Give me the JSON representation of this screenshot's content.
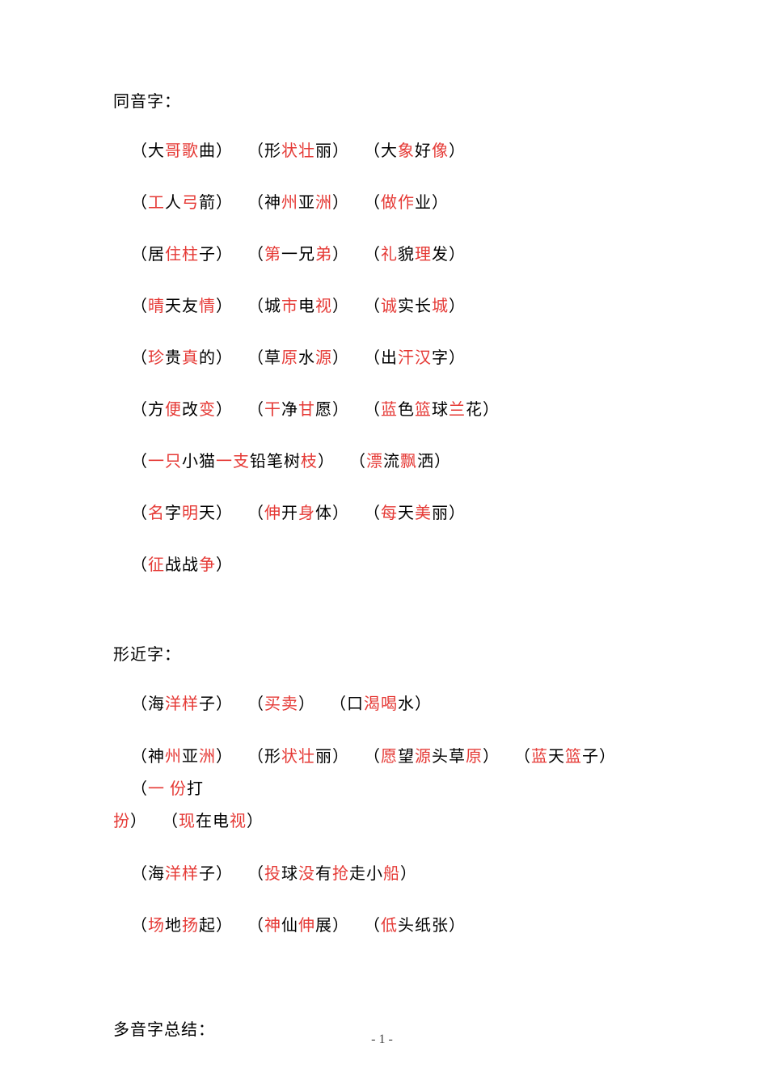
{
  "footer": {
    "pageNumber": "- 1 -"
  },
  "sections": {
    "homophones": {
      "title": "同音字：",
      "rows": [
        [
          {
            "segs": [
              {
                "t": "（大",
                "r": 0
              },
              {
                "t": "哥歌",
                "r": 1
              },
              {
                "t": "曲）",
                "r": 0
              }
            ]
          },
          {
            "segs": [
              {
                "t": "（形",
                "r": 0
              },
              {
                "t": "状壮",
                "r": 1
              },
              {
                "t": "丽）",
                "r": 0
              }
            ]
          },
          {
            "segs": [
              {
                "t": "（大",
                "r": 0
              },
              {
                "t": "象",
                "r": 1
              },
              {
                "t": "好",
                "r": 0
              },
              {
                "t": "像",
                "r": 1
              },
              {
                "t": "）",
                "r": 0
              }
            ]
          }
        ],
        [
          {
            "segs": [
              {
                "t": "（",
                "r": 0
              },
              {
                "t": "工",
                "r": 1
              },
              {
                "t": "人",
                "r": 0
              },
              {
                "t": "弓",
                "r": 1
              },
              {
                "t": "箭）",
                "r": 0
              }
            ]
          },
          {
            "segs": [
              {
                "t": "（神",
                "r": 0
              },
              {
                "t": "州",
                "r": 1
              },
              {
                "t": "亚",
                "r": 0
              },
              {
                "t": "洲",
                "r": 1
              },
              {
                "t": "）",
                "r": 0
              }
            ]
          },
          {
            "segs": [
              {
                "t": "（",
                "r": 0
              },
              {
                "t": "做作",
                "r": 1
              },
              {
                "t": "业）",
                "r": 0
              }
            ]
          }
        ],
        [
          {
            "segs": [
              {
                "t": "（居",
                "r": 0
              },
              {
                "t": "住柱",
                "r": 1
              },
              {
                "t": "子）",
                "r": 0
              }
            ]
          },
          {
            "segs": [
              {
                "t": "（",
                "r": 0
              },
              {
                "t": "第",
                "r": 1
              },
              {
                "t": "一兄",
                "r": 0
              },
              {
                "t": "弟",
                "r": 1
              },
              {
                "t": "）",
                "r": 0
              }
            ]
          },
          {
            "segs": [
              {
                "t": "（",
                "r": 0
              },
              {
                "t": "礼",
                "r": 1
              },
              {
                "t": "貌",
                "r": 0
              },
              {
                "t": "理",
                "r": 1
              },
              {
                "t": "发）",
                "r": 0
              }
            ]
          }
        ],
        [
          {
            "segs": [
              {
                "t": "（",
                "r": 0
              },
              {
                "t": "晴",
                "r": 1
              },
              {
                "t": "天友",
                "r": 0
              },
              {
                "t": "情",
                "r": 1
              },
              {
                "t": "）",
                "r": 0
              }
            ]
          },
          {
            "segs": [
              {
                "t": "（城",
                "r": 0
              },
              {
                "t": "市",
                "r": 1
              },
              {
                "t": "电",
                "r": 0
              },
              {
                "t": "视",
                "r": 1
              },
              {
                "t": "）",
                "r": 0
              }
            ]
          },
          {
            "segs": [
              {
                "t": "（",
                "r": 0
              },
              {
                "t": "诚",
                "r": 1
              },
              {
                "t": "实长",
                "r": 0
              },
              {
                "t": "城",
                "r": 1
              },
              {
                "t": "）",
                "r": 0
              }
            ]
          }
        ],
        [
          {
            "segs": [
              {
                "t": "（",
                "r": 0
              },
              {
                "t": "珍",
                "r": 1
              },
              {
                "t": "贵",
                "r": 0
              },
              {
                "t": "真",
                "r": 1
              },
              {
                "t": "的）",
                "r": 0
              }
            ]
          },
          {
            "segs": [
              {
                "t": "（草",
                "r": 0
              },
              {
                "t": "原",
                "r": 1
              },
              {
                "t": "水",
                "r": 0
              },
              {
                "t": "源",
                "r": 1
              },
              {
                "t": "）",
                "r": 0
              }
            ]
          },
          {
            "segs": [
              {
                "t": "（出",
                "r": 0
              },
              {
                "t": "汗汉",
                "r": 1
              },
              {
                "t": "字）",
                "r": 0
              }
            ]
          }
        ],
        [
          {
            "segs": [
              {
                "t": "（方",
                "r": 0
              },
              {
                "t": "便",
                "r": 1
              },
              {
                "t": "改",
                "r": 0
              },
              {
                "t": "变",
                "r": 1
              },
              {
                "t": "）",
                "r": 0
              }
            ]
          },
          {
            "segs": [
              {
                "t": "（",
                "r": 0
              },
              {
                "t": "干",
                "r": 1
              },
              {
                "t": "净",
                "r": 0
              },
              {
                "t": "甘",
                "r": 1
              },
              {
                "t": "愿）",
                "r": 0
              }
            ]
          },
          {
            "segs": [
              {
                "t": "（",
                "r": 0
              },
              {
                "t": "蓝",
                "r": 1
              },
              {
                "t": "色",
                "r": 0
              },
              {
                "t": "篮",
                "r": 1
              },
              {
                "t": "球",
                "r": 0
              },
              {
                "t": "兰",
                "r": 1
              },
              {
                "t": "花）",
                "r": 0
              }
            ]
          }
        ],
        [
          {
            "segs": [
              {
                "t": "（",
                "r": 0
              },
              {
                "t": "一只",
                "r": 1
              },
              {
                "t": "小猫",
                "r": 0
              },
              {
                "t": "一支",
                "r": 1
              },
              {
                "t": "铅笔树",
                "r": 0
              },
              {
                "t": "枝",
                "r": 1
              },
              {
                "t": "）",
                "r": 0
              }
            ]
          },
          {
            "segs": [
              {
                "t": "（",
                "r": 0
              },
              {
                "t": "漂",
                "r": 1
              },
              {
                "t": "流",
                "r": 0
              },
              {
                "t": "飘",
                "r": 1
              },
              {
                "t": "洒）",
                "r": 0
              }
            ]
          }
        ],
        [
          {
            "segs": [
              {
                "t": "（",
                "r": 0
              },
              {
                "t": "名",
                "r": 1
              },
              {
                "t": "字",
                "r": 0
              },
              {
                "t": "明",
                "r": 1
              },
              {
                "t": "天）",
                "r": 0
              }
            ]
          },
          {
            "segs": [
              {
                "t": "（",
                "r": 0
              },
              {
                "t": "伸",
                "r": 1
              },
              {
                "t": "开",
                "r": 0
              },
              {
                "t": "身",
                "r": 1
              },
              {
                "t": "体）",
                "r": 0
              }
            ]
          },
          {
            "segs": [
              {
                "t": "（",
                "r": 0
              },
              {
                "t": "每",
                "r": 1
              },
              {
                "t": "天",
                "r": 0
              },
              {
                "t": "美",
                "r": 1
              },
              {
                "t": "丽）",
                "r": 0
              }
            ]
          }
        ],
        [
          {
            "segs": [
              {
                "t": "（",
                "r": 0
              },
              {
                "t": "征",
                "r": 1
              },
              {
                "t": "战战",
                "r": 0
              },
              {
                "t": "争",
                "r": 1
              },
              {
                "t": "）",
                "r": 0
              }
            ]
          }
        ]
      ]
    },
    "similar": {
      "title": "形近字：",
      "rows": [
        [
          {
            "segs": [
              {
                "t": "（海",
                "r": 0
              },
              {
                "t": "洋样",
                "r": 1
              },
              {
                "t": "子）",
                "r": 0
              }
            ]
          },
          {
            "segs": [
              {
                "t": "（",
                "r": 0
              },
              {
                "t": "买卖",
                "r": 1
              },
              {
                "t": "）",
                "r": 0
              }
            ]
          },
          {
            "segs": [
              {
                "t": "（口",
                "r": 0
              },
              {
                "t": "渴喝",
                "r": 1
              },
              {
                "t": "水）",
                "r": 0
              }
            ]
          }
        ],
        [
          {
            "segs": [
              {
                "t": "（神",
                "r": 0
              },
              {
                "t": "州",
                "r": 1
              },
              {
                "t": "亚",
                "r": 0
              },
              {
                "t": "洲",
                "r": 1
              },
              {
                "t": "）",
                "r": 0
              }
            ]
          },
          {
            "segs": [
              {
                "t": "（形",
                "r": 0
              },
              {
                "t": "状壮",
                "r": 1
              },
              {
                "t": "丽）",
                "r": 0
              }
            ]
          },
          {
            "segs": [
              {
                "t": "（",
                "r": 0
              },
              {
                "t": "愿",
                "r": 1
              },
              {
                "t": "望",
                "r": 0
              },
              {
                "t": "源",
                "r": 1
              },
              {
                "t": "头草",
                "r": 0
              },
              {
                "t": "原",
                "r": 1
              },
              {
                "t": "）",
                "r": 0
              }
            ]
          },
          {
            "segs": [
              {
                "t": "（",
                "r": 0
              },
              {
                "t": "蓝",
                "r": 1
              },
              {
                "t": "天",
                "r": 0
              },
              {
                "t": "篮",
                "r": 1
              },
              {
                "t": "子）",
                "r": 0
              }
            ]
          },
          {
            "segs": [
              {
                "t": "（",
                "r": 0
              },
              {
                "t": "一 份",
                "r": 1
              },
              {
                "t": "打",
                "r": 0
              }
            ]
          },
          {
            "segs": [
              {
                "t": "扮",
                "r": 1
              },
              {
                "t": "）",
                "r": 0
              }
            ],
            "break": true
          },
          {
            "segs": [
              {
                "t": "（",
                "r": 0
              },
              {
                "t": "现",
                "r": 1
              },
              {
                "t": "在电",
                "r": 0
              },
              {
                "t": "视",
                "r": 1
              },
              {
                "t": "）",
                "r": 0
              }
            ]
          }
        ],
        [
          {
            "segs": [
              {
                "t": "（海",
                "r": 0
              },
              {
                "t": "洋样",
                "r": 1
              },
              {
                "t": "子）",
                "r": 0
              }
            ]
          },
          {
            "segs": [
              {
                "t": "（",
                "r": 0
              },
              {
                "t": "投",
                "r": 1
              },
              {
                "t": "球",
                "r": 0
              },
              {
                "t": "没",
                "r": 1
              },
              {
                "t": "有",
                "r": 0
              },
              {
                "t": "抢",
                "r": 1
              },
              {
                "t": "走小",
                "r": 0
              },
              {
                "t": "船",
                "r": 1
              },
              {
                "t": "）",
                "r": 0
              }
            ]
          }
        ],
        [
          {
            "segs": [
              {
                "t": "（",
                "r": 0
              },
              {
                "t": "场",
                "r": 1
              },
              {
                "t": "地",
                "r": 0
              },
              {
                "t": "扬",
                "r": 1
              },
              {
                "t": "起）",
                "r": 0
              }
            ]
          },
          {
            "segs": [
              {
                "t": "（",
                "r": 0
              },
              {
                "t": "神",
                "r": 1
              },
              {
                "t": "仙",
                "r": 0
              },
              {
                "t": "伸",
                "r": 1
              },
              {
                "t": "展）",
                "r": 0
              }
            ]
          },
          {
            "segs": [
              {
                "t": "（",
                "r": 0
              },
              {
                "t": "低",
                "r": 1
              },
              {
                "t": "头纸张）",
                "r": 0
              }
            ]
          }
        ]
      ]
    },
    "poly": {
      "title": "多音字总结："
    }
  }
}
